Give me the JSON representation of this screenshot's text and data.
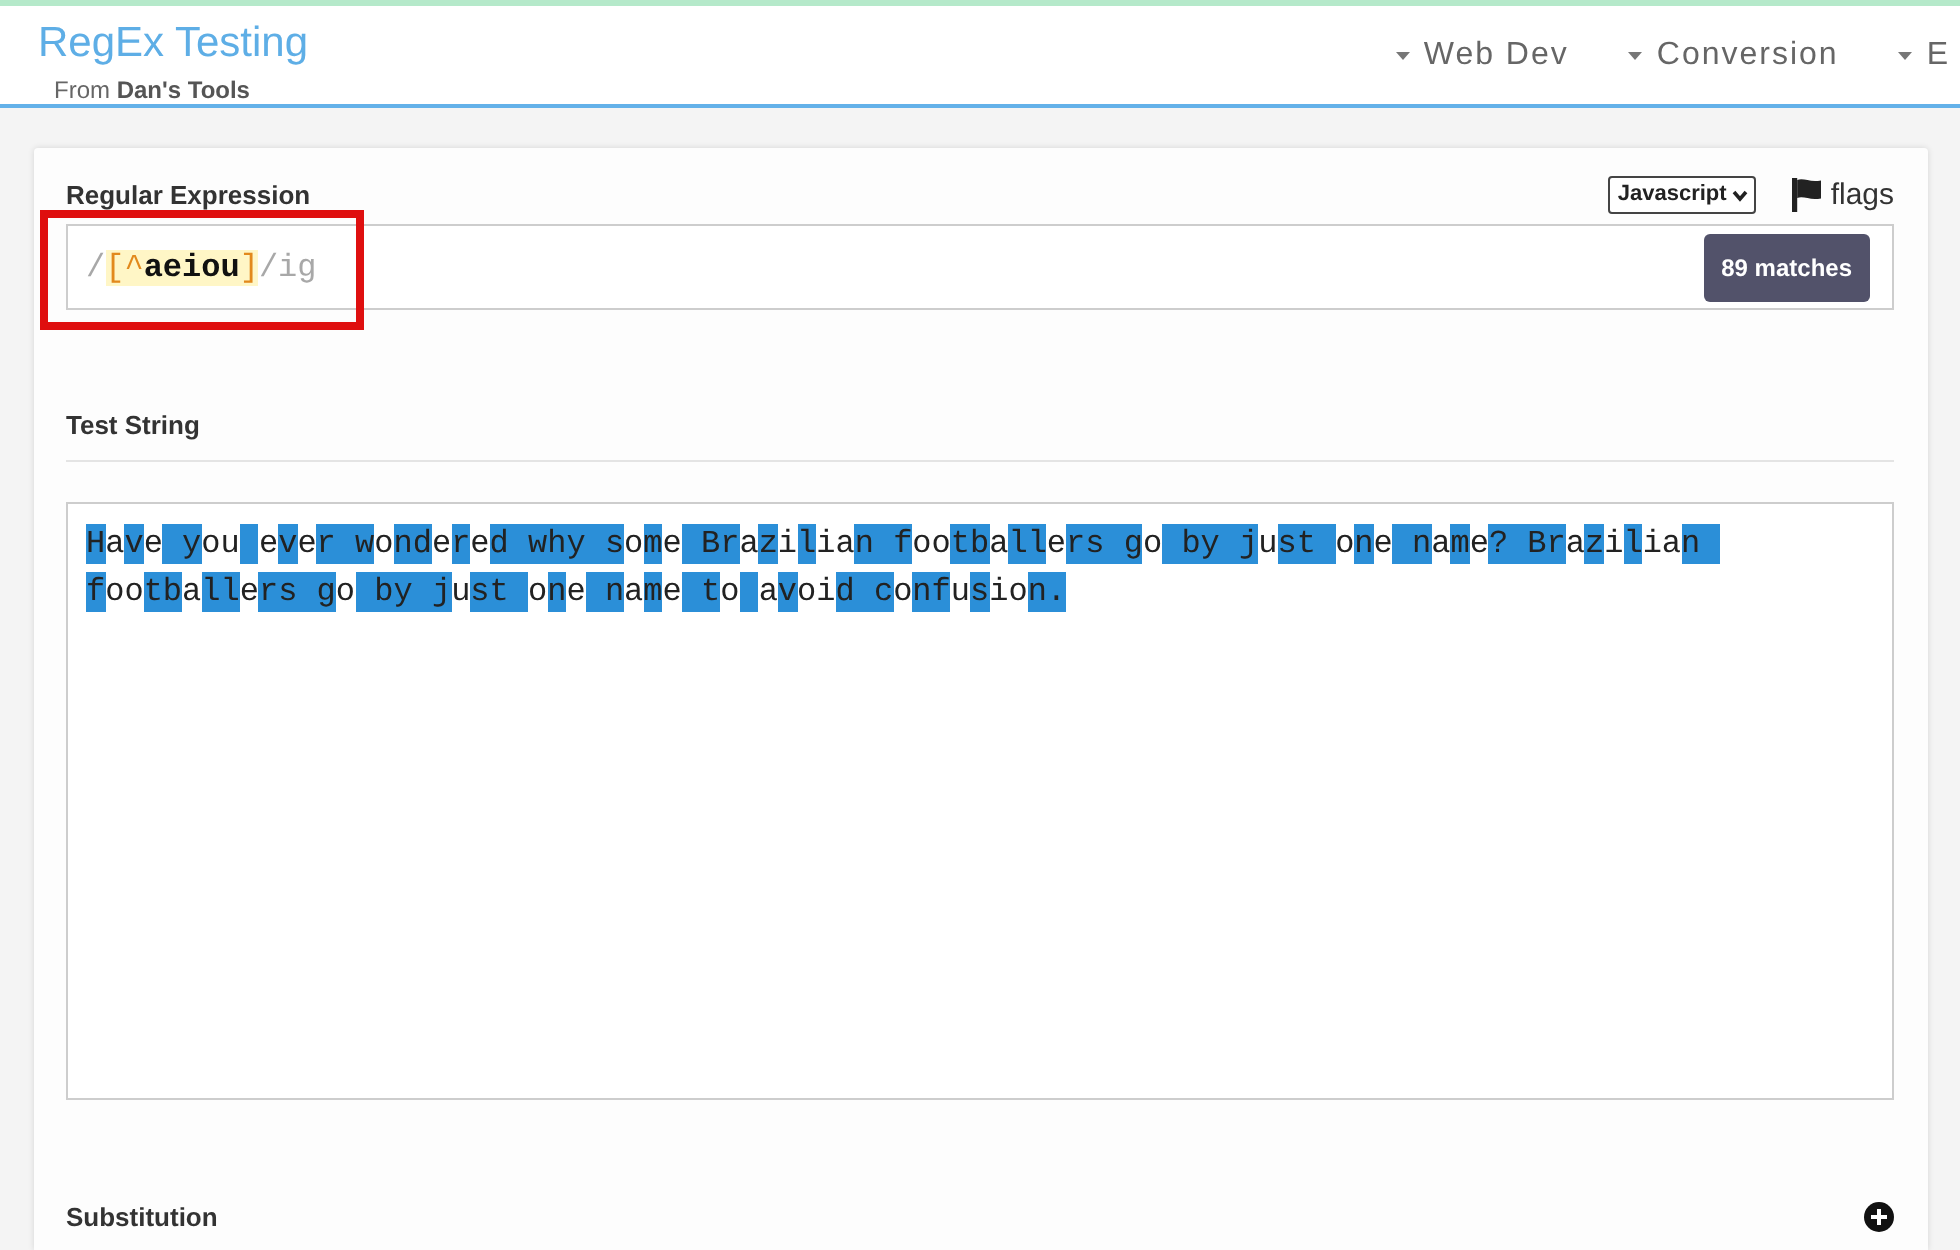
{
  "header": {
    "title": "RegEx Testing",
    "subtitle": "From **Dan's Tools**"
  },
  "nav": [
    {
      "label": "Web Dev"
    },
    {
      "label": "Conversion"
    },
    {
      "label": "E"
    }
  ],
  "regex_panel": {
    "label": "Regular Expression",
    "language": "Javascript",
    "flags_label": "flags",
    "expression": [
      {
        "kind": "delimiter",
        "text": "/"
      },
      {
        "kind": "class_open",
        "text": "[^"
      },
      {
        "kind": "class_body",
        "text": "aeiou"
      },
      {
        "kind": "class_close",
        "text": "]"
      },
      {
        "kind": "delimiter",
        "text": "/"
      },
      {
        "kind": "flags",
        "text": "ig"
      }
    ],
    "match_count": "89 matches",
    "framed": true
  },
  "test_panel": {
    "label": "Test String",
    "text": "Have you ever wondered why some Brazilian footballers go by just one name? Brazilian footballers go by just one name to avoid confusion."
  },
  "substitution_panel": {
    "label": "Substitution"
  }
}
